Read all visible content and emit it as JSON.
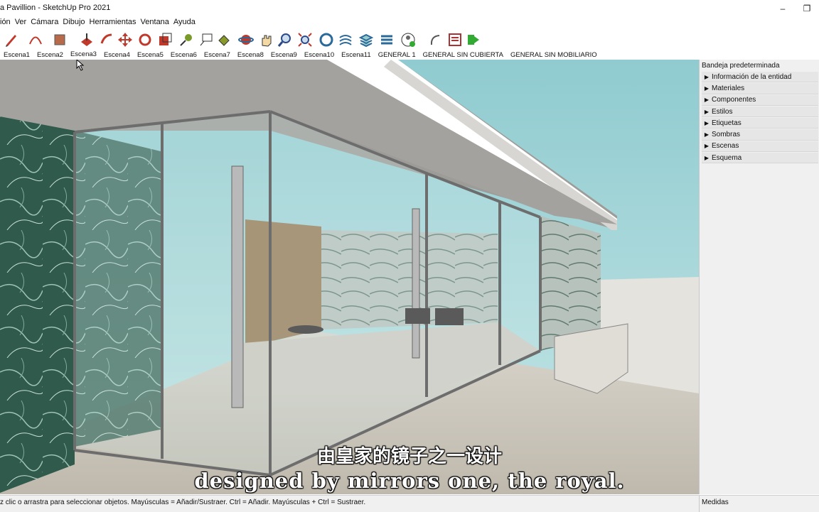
{
  "window": {
    "title": "a Pavillion - SketchUp Pro 2021",
    "minimize": "–",
    "maximize": "❐"
  },
  "menu": [
    "ión",
    "Ver",
    "Cámara",
    "Dibujo",
    "Herramientas",
    "Ventana",
    "Ayuda"
  ],
  "toolbar_icons": [
    "pencil-icon",
    "arc-icon",
    "eraser-paint-icon",
    "push-pull-icon",
    "follow-me-icon",
    "move-icon",
    "rotate-icon",
    "scale-icon",
    "tape-measure-icon",
    "text-icon",
    "paint-bucket-icon",
    "orbit-icon",
    "pan-icon",
    "zoom-icon",
    "zoom-extents-icon",
    "component-options-icon",
    "sandbox-icon",
    "layers-icon",
    "outliner-icon",
    "profile-icon",
    "select-icon",
    "scene-manager-icon",
    "extension-icon"
  ],
  "scenes": {
    "tabs": [
      "Escena1",
      "Escena2",
      "Escena3",
      "Escena4",
      "Escena5",
      "Escena6",
      "Escena7",
      "Escena8",
      "Escena9",
      "Escena10",
      "Escena11",
      "GENERAL 1",
      "GENERAL SIN CUBIERTA",
      "GENERAL SIN MOBILIARIO"
    ],
    "active_index": 2
  },
  "tray": {
    "title": "Bandeja predeterminada",
    "items": [
      "Información de la entidad",
      "Materiales",
      "Componentes",
      "Estilos",
      "Etiquetas",
      "Sombras",
      "Escenas",
      "Esquema"
    ]
  },
  "status": {
    "text": "z clic o arrastra para seleccionar objetos. Mayúsculas = Añadir/Sustraer. Ctrl = Añadir. Mayúsculas + Ctrl = Sustraer.",
    "measure_label": "Medidas"
  },
  "subtitles": {
    "chinese": "由皇家的镜子之一设计",
    "english": "designed by mirrors one, the royal."
  },
  "colors": {
    "sky": "#a9d6da",
    "marble_green": "#2f5a4c",
    "onyx": "#9a7a55",
    "floor": "#cfcac0"
  }
}
